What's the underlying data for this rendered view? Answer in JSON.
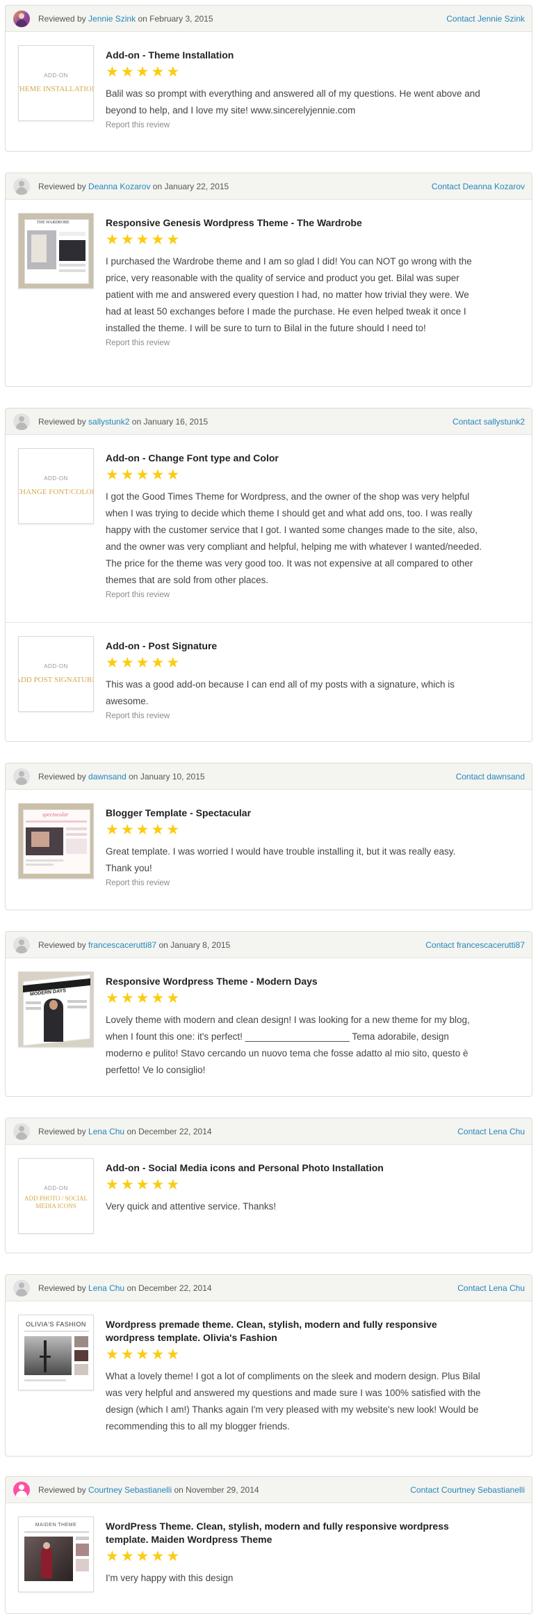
{
  "colors": {
    "link": "#2387b8",
    "star": "#fbcc12",
    "header_bg": "#f4f4f1"
  },
  "reviews": [
    {
      "reviewed_by": "Reviewed by",
      "reviewer": "Jennie Szink",
      "on": "on",
      "date": "February 3, 2015",
      "contact": "Contact Jennie Szink",
      "items": [
        {
          "title": "Add-on - Theme Installation",
          "thumb_top": "ADD-ON",
          "thumb_text": "THEME INSTALLATION",
          "rating": 5,
          "text": "Balil was so prompt with everything and answered all of my questions. He went above and beyond to help, and I love my site! www.sincerelyjennie.com",
          "report": "Report this review"
        }
      ]
    },
    {
      "reviewed_by": "Reviewed by",
      "reviewer": "Deanna Kozarov",
      "on": "on",
      "date": "January 22, 2015",
      "contact": "Contact Deanna Kozarov",
      "items": [
        {
          "title": "Responsive Genesis Wordpress Theme - The Wardrobe",
          "thumb_caption": "THE WARDROBE",
          "rating": 5,
          "text": "I purchased the Wardrobe theme and I am so glad I did! You can NOT go wrong with the price, very reasonable with the quality of service and product you get. Bilal was super patient with me and answered every question I had, no matter how trivial they were. We had at least 50 exchanges before I made the purchase. He even helped tweak it once I installed the theme. I will be sure to turn to Bilal in the future should I need to!",
          "report": "Report this review"
        }
      ]
    },
    {
      "reviewed_by": "Reviewed by",
      "reviewer": "sallystunk2",
      "on": "on",
      "date": "January 16, 2015",
      "contact": "Contact sallystunk2",
      "items": [
        {
          "title": "Add-on - Change Font type and Color",
          "thumb_top": "ADD-ON",
          "thumb_text": "CHANGE FONT/COLOR",
          "rating": 5,
          "text": "I got the Good Times Theme for Wordpress, and the owner of the shop was very helpful when I was trying to decide which theme I should get and what add ons, too. I was really happy with the customer service that I got. I wanted some changes made to the site, also, and the owner was very compliant and helpful, helping me with whatever I wanted/needed. The price for the theme was very good too. It was not expensive at all compared to other themes that are sold from other places.",
          "report": "Report this review"
        },
        {
          "title": "Add-on - Post Signature",
          "thumb_top": "ADD-ON",
          "thumb_text": "ADD POST SIGNATURE",
          "rating": 5,
          "text": "This was a good add-on because I can end all of my posts with a signature, which is awesome.",
          "report": "Report this review"
        }
      ]
    },
    {
      "reviewed_by": "Reviewed by",
      "reviewer": "dawnsand",
      "on": "on",
      "date": "January 10, 2015",
      "contact": "Contact dawnsand",
      "items": [
        {
          "title": "Blogger Template - Spectacular",
          "thumb_caption": "spectacular",
          "rating": 5,
          "text": "Great template. I was worried I would have trouble installing it, but it was really easy. Thank you!",
          "report": "Report this review"
        }
      ]
    },
    {
      "reviewed_by": "Reviewed by",
      "reviewer": "francescacerutti87",
      "on": "on",
      "date": "January 8, 2015",
      "contact": "Contact francescacerutti87",
      "items": [
        {
          "title": "Responsive Wordpress Theme - Modern Days",
          "thumb_caption": "MODERN DAYS",
          "rating": 5,
          "text": "Lovely theme with modern and clean design! I was looking for a new theme for my blog, when I fount this one: it's perfect! ____________________ Tema adorabile, design moderno e pulito! Stavo cercando un nuovo tema che fosse adatto al mio sito, questo è perfetto! Ve lo consiglio!"
        }
      ]
    },
    {
      "reviewed_by": "Reviewed by",
      "reviewer": "Lena Chu",
      "on": "on",
      "date": "December 22, 2014",
      "contact": "Contact Lena Chu",
      "items": [
        {
          "title": "Add-on - Social Media icons and Personal Photo Installation",
          "thumb_top": "ADD-ON",
          "thumb_text": "ADD PHOTO / SOCIAL MEDIA ICONS",
          "rating": 5,
          "text": "Very quick and attentive service. Thanks!"
        }
      ]
    },
    {
      "reviewed_by": "Reviewed by",
      "reviewer": "Lena Chu",
      "on": "on",
      "date": "December 22, 2014",
      "contact": "Contact Lena Chu",
      "items": [
        {
          "title": "Wordpress premade theme. Clean, stylish, modern and fully responsive wordpress template. Olivia's Fashion",
          "thumb_caption": "OLIVIA'S FASHION",
          "rating": 5,
          "text": "What a lovely theme! I got a lot of compliments on the sleek and modern design. Plus Bilal was very helpful and answered my questions and made sure I was 100% satisfied with the design (which I am!) Thanks again I'm very pleased with my website's new look! Would be recommending this to all my blogger friends."
        }
      ]
    },
    {
      "reviewed_by": "Reviewed by",
      "reviewer": "Courtney Sebastianelli",
      "on": "on",
      "date": "November 29, 2014",
      "contact": "Contact Courtney Sebastianelli",
      "items": [
        {
          "title": "WordPress Theme. Clean, stylish, modern and fully responsive wordpress template. Maiden Wordpress Theme",
          "thumb_caption": "MAIDEN THEME",
          "rating": 5,
          "text": "I'm very happy with this design"
        }
      ]
    }
  ]
}
